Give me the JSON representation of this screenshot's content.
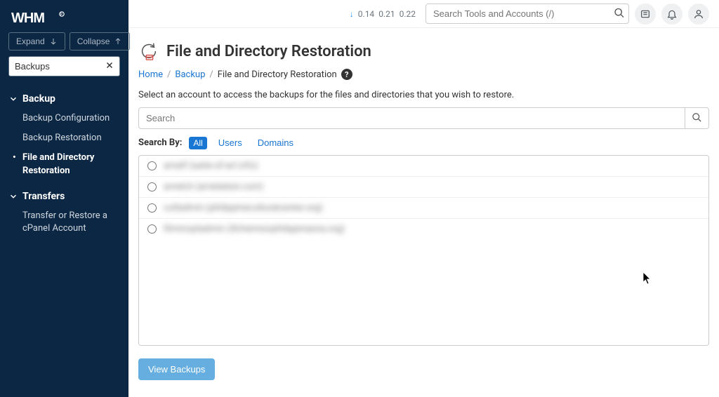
{
  "app_name": "WHM",
  "sidebar": {
    "expand_label": "Expand",
    "collapse_label": "Collapse",
    "search_value": "Backups",
    "groups": [
      {
        "label": "Backup",
        "items": [
          {
            "label": "Backup Configuration",
            "active": false
          },
          {
            "label": "Backup Restoration",
            "active": false
          },
          {
            "label": "File and Directory Restoration",
            "active": true
          }
        ]
      },
      {
        "label": "Transfers",
        "items": [
          {
            "label": "Transfer or Restore a cPanel Account",
            "active": false
          }
        ]
      }
    ]
  },
  "topbar": {
    "load1": "0.14",
    "load5": "0.21",
    "load15": "0.22",
    "search_placeholder": "Search Tools and Accounts (/)"
  },
  "page": {
    "title": "File and Directory Restoration",
    "breadcrumb_home": "Home",
    "breadcrumb_parent": "Backup",
    "breadcrumb_current": "File and Directory Restoration",
    "description": "Select an account to access the backups for the files and directories that you wish to restore.",
    "search_placeholder": "Search",
    "search_by_label": "Search By:",
    "filters": {
      "all": "All",
      "users": "Users",
      "domains": "Domains"
    },
    "accounts": [
      {
        "label": "arnelf (saite-of-art.info)"
      },
      {
        "label": "arnelch (arnelatest.com)"
      },
      {
        "label": "cultadmin (philippineculturalcenter.org)"
      },
      {
        "label": "filminoptadmin (illchemisophilippinasna.org)"
      }
    ],
    "view_backups_label": "View Backups"
  }
}
